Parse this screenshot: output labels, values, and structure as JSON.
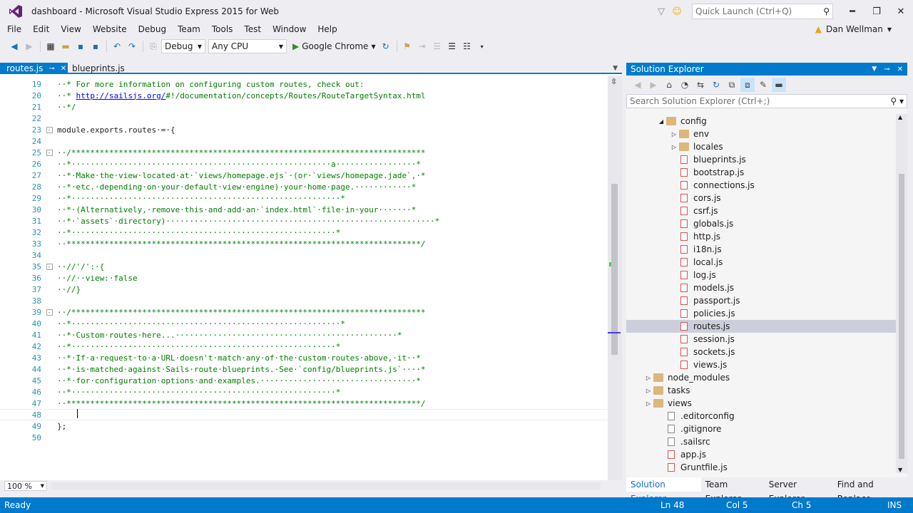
{
  "window": {
    "title": "dashboard - Microsoft Visual Studio Express 2015 for Web",
    "quick_launch_placeholder": "Quick Launch (Ctrl+Q)"
  },
  "menu": [
    "File",
    "Edit",
    "View",
    "Website",
    "Debug",
    "Team",
    "Tools",
    "Test",
    "Window",
    "Help"
  ],
  "user": {
    "name": "Dan Wellman"
  },
  "toolbar": {
    "config": "Debug",
    "platform": "Any CPU",
    "run_target": "Google Chrome"
  },
  "tabs": [
    {
      "label": "routes.js",
      "active": true
    },
    {
      "label": "blueprints.js",
      "active": false
    }
  ],
  "editor": {
    "lines": [
      {
        "n": "19",
        "text": "··* For more information on configuring custom routes, check out:",
        "type": "comment"
      },
      {
        "n": "20",
        "text": "··* ",
        "link": "http://sailsjs.org/",
        "after": "#!/documentation/concepts/Routes/RouteTargetSyntax.html",
        "type": "comment-link"
      },
      {
        "n": "21",
        "text": "··*/",
        "type": "comment"
      },
      {
        "n": "22",
        "text": "",
        "type": "code"
      },
      {
        "n": "23",
        "text": "module.exports.routes·=·{",
        "type": "code",
        "fold": "-"
      },
      {
        "n": "24",
        "text": "",
        "type": "code"
      },
      {
        "n": "25",
        "text": "··/***************************************************************************",
        "type": "comment",
        "fold": "-"
      },
      {
        "n": "26",
        "text": "··*·······················································a·················*",
        "type": "comment"
      },
      {
        "n": "27",
        "text": "··*·Make·the·view·located·at·`views/homepage.ejs`·(or·`views/homepage.jade`,·*",
        "type": "comment"
      },
      {
        "n": "28",
        "text": "··*·etc.·depending·on·your·default·view·engine)·your·home·page.············*",
        "type": "comment"
      },
      {
        "n": "29",
        "text": "··*·························································*",
        "type": "comment"
      },
      {
        "n": "30",
        "text": "··*·(Alternatively,·remove·this·and·add·an·`index.html`·file·in·your·······*",
        "type": "comment"
      },
      {
        "n": "31",
        "text": "··*·`assets`·directory)·························································*",
        "type": "comment"
      },
      {
        "n": "32",
        "text": "··*························································*",
        "type": "comment"
      },
      {
        "n": "33",
        "text": "··***************************************************************************/",
        "type": "comment"
      },
      {
        "n": "34",
        "text": "",
        "type": "code"
      },
      {
        "n": "35",
        "text": "··//'/':·{",
        "type": "comment",
        "fold": "-"
      },
      {
        "n": "36",
        "text": "··//··view:·false",
        "type": "comment"
      },
      {
        "n": "37",
        "text": "··//}",
        "type": "comment"
      },
      {
        "n": "38",
        "text": "",
        "type": "code"
      },
      {
        "n": "39",
        "text": "··/***************************************************************************",
        "type": "comment",
        "fold": "-"
      },
      {
        "n": "40",
        "text": "··*·························································*",
        "type": "comment"
      },
      {
        "n": "41",
        "text": "··*·Custom·routes·here...···············································*",
        "type": "comment"
      },
      {
        "n": "42",
        "text": "··*························································*",
        "type": "comment"
      },
      {
        "n": "43",
        "text": "··*·If·a·request·to·a·URL·doesn't·match·any·of·the·custom·routes·above,·it··*",
        "type": "comment"
      },
      {
        "n": "44",
        "text": "··*·is·matched·against·Sails·route·blueprints.·See·`config/blueprints.js`····*",
        "type": "comment"
      },
      {
        "n": "45",
        "text": "··*·for·configuration·options·and·examples.·································*",
        "type": "comment"
      },
      {
        "n": "46",
        "text": "··*························································*",
        "type": "comment"
      },
      {
        "n": "47",
        "text": "··***************************************************************************/",
        "type": "comment"
      },
      {
        "n": "48",
        "text": "",
        "type": "current"
      },
      {
        "n": "49",
        "text": "};",
        "type": "code"
      },
      {
        "n": "50",
        "text": "",
        "type": "code"
      }
    ],
    "zoom": "100 %"
  },
  "solution_explorer": {
    "title": "Solution Explorer",
    "search_placeholder": "Search Solution Explorer (Ctrl+;)",
    "items": [
      {
        "label": "config",
        "kind": "folder",
        "indent": 1,
        "arrow": "open"
      },
      {
        "label": "env",
        "kind": "folder",
        "indent": 2,
        "arrow": "closed"
      },
      {
        "label": "locales",
        "kind": "folder",
        "indent": 2,
        "arrow": "closed"
      },
      {
        "label": "blueprints.js",
        "kind": "js",
        "indent": 2
      },
      {
        "label": "bootstrap.js",
        "kind": "js",
        "indent": 2
      },
      {
        "label": "connections.js",
        "kind": "js",
        "indent": 2
      },
      {
        "label": "cors.js",
        "kind": "js",
        "indent": 2
      },
      {
        "label": "csrf.js",
        "kind": "js",
        "indent": 2
      },
      {
        "label": "globals.js",
        "kind": "js",
        "indent": 2
      },
      {
        "label": "http.js",
        "kind": "js",
        "indent": 2
      },
      {
        "label": "i18n.js",
        "kind": "js",
        "indent": 2
      },
      {
        "label": "local.js",
        "kind": "js",
        "indent": 2
      },
      {
        "label": "log.js",
        "kind": "js",
        "indent": 2
      },
      {
        "label": "models.js",
        "kind": "js",
        "indent": 2
      },
      {
        "label": "passport.js",
        "kind": "js",
        "indent": 2
      },
      {
        "label": "policies.js",
        "kind": "js",
        "indent": 2
      },
      {
        "label": "routes.js",
        "kind": "js",
        "indent": 2,
        "selected": true
      },
      {
        "label": "session.js",
        "kind": "js",
        "indent": 2
      },
      {
        "label": "sockets.js",
        "kind": "js",
        "indent": 2
      },
      {
        "label": "views.js",
        "kind": "js",
        "indent": 2
      },
      {
        "label": "node_modules",
        "kind": "folder",
        "indent": 0,
        "arrow": "closed"
      },
      {
        "label": "tasks",
        "kind": "folder",
        "indent": 0,
        "arrow": "closed"
      },
      {
        "label": "views",
        "kind": "folder",
        "indent": 0,
        "arrow": "closed"
      },
      {
        "label": ".editorconfig",
        "kind": "doc",
        "indent": 1
      },
      {
        "label": ".gitignore",
        "kind": "doc",
        "indent": 1
      },
      {
        "label": ".sailsrc",
        "kind": "doc",
        "indent": 1
      },
      {
        "label": "app.js",
        "kind": "js",
        "indent": 1
      },
      {
        "label": "Gruntfile.js",
        "kind": "js",
        "indent": 1
      }
    ],
    "bottom_tabs": [
      "Solution Explorer",
      "Team Explorer",
      "Server Explorer",
      "Find and Replace"
    ]
  },
  "status": {
    "state": "Ready",
    "line": "Ln 48",
    "col": "Col 5",
    "ch": "Ch 5",
    "mode": "INS"
  },
  "colors": {
    "accent": "#007acc",
    "comment": "#008000",
    "line_number": "#2b91af"
  }
}
